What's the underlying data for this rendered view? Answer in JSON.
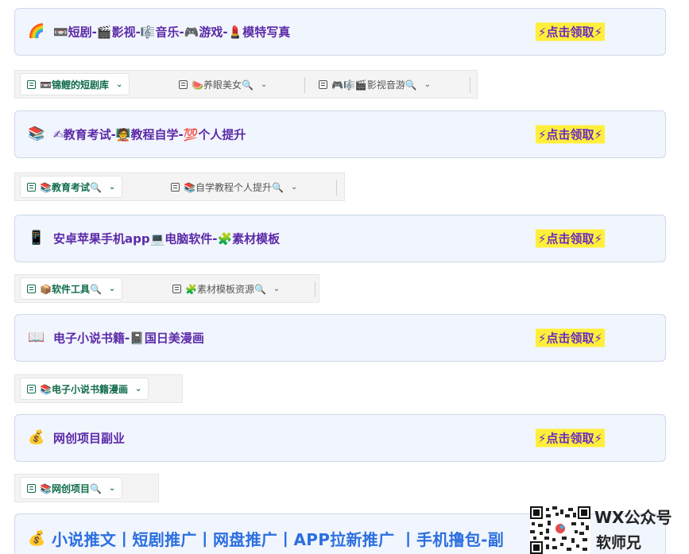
{
  "claim_label": "⚡点击领取⚡",
  "cards": [
    {
      "emoji": "🌈",
      "title": "📼短剧-🎬影视-🎼音乐-🎮游戏-💄模特写真"
    },
    {
      "emoji": "📚",
      "title": "✍教育考试-🧑‍🏫教程自学-💯个人提升"
    },
    {
      "emoji": "📱",
      "title": "安卓苹果手机app💻电脑软件-🧩素材模板"
    },
    {
      "emoji": "📖",
      "title": "电子小说书籍-📓国日美漫画"
    },
    {
      "emoji": "💰",
      "title": "网创项目副业"
    }
  ],
  "tabbars": [
    [
      {
        "label": "📼锦鲤的短剧库",
        "active": true
      },
      {
        "label": "🍉养眼美女🔍",
        "active": false
      },
      {
        "label": "🎮🎼🎬影视音游🔍",
        "active": false
      }
    ],
    [
      {
        "label": "📚教育考试🔍",
        "active": true
      },
      {
        "label": "📚自学教程个人提升🔍",
        "active": false
      }
    ],
    [
      {
        "label": "📦软件工具🔍",
        "active": true
      },
      {
        "label": "🧩素材模板资源🔍",
        "active": false
      }
    ],
    [
      {
        "label": "📚电子小说书籍漫画",
        "active": true
      }
    ],
    [
      {
        "label": "📚网创项目🔍",
        "active": true
      }
    ]
  ],
  "promo": {
    "emoji": "💰",
    "title": "小说推文丨短剧推广丨网盘推广丨APP拉新推广 丨手机撸包-副"
  },
  "watermark": {
    "line1": "WX公众号",
    "line2": "软师兄"
  },
  "icons": {
    "tab_list": "list-icon",
    "tab_caret": "chevron-down-icon",
    "qr": "qr-code-icon"
  },
  "colors": {
    "card_bg": "#f1f5fd",
    "title": "#5b2aa8",
    "claim_bg": "#ffef3a",
    "active_tab": "#0f6b4a",
    "promo": "#2b6fe0"
  }
}
